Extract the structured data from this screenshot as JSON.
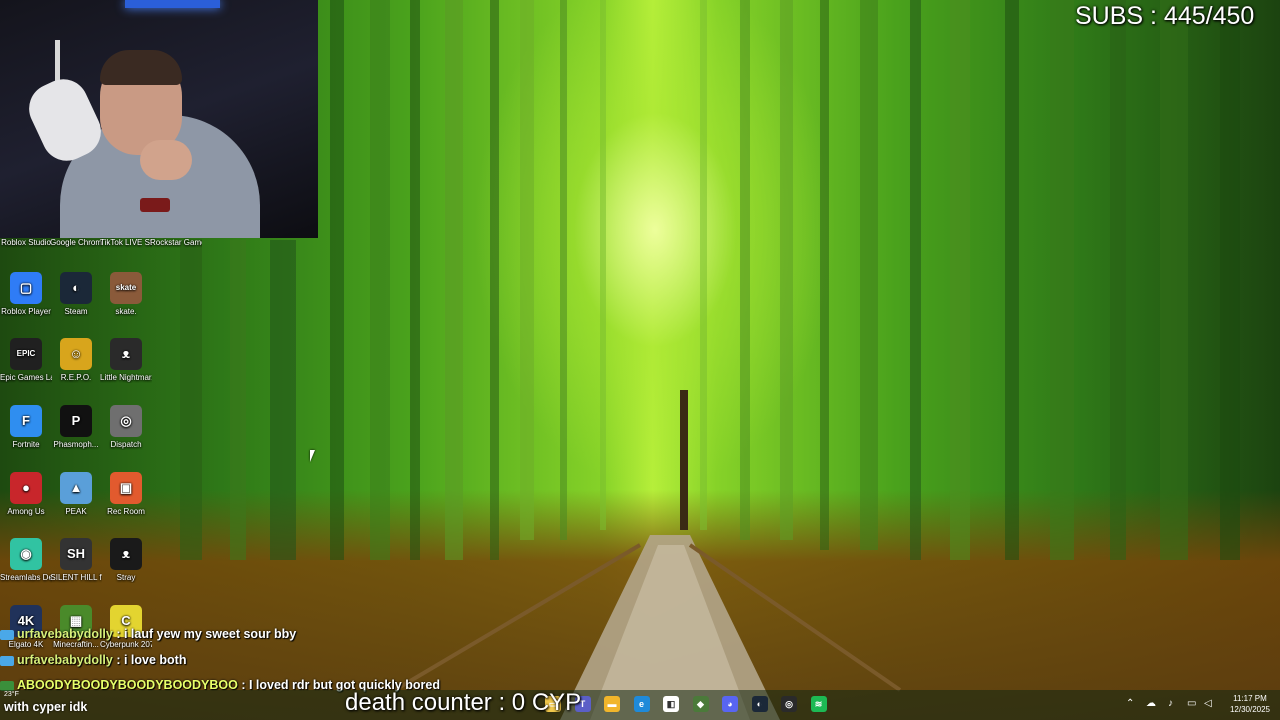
{
  "overlay": {
    "subs": "SUBS : 445/450",
    "death_counter": "death counter : 0",
    "partial_cyp": "CYP"
  },
  "desktop_icons": [
    {
      "label": "Roblox Studio",
      "color": "#1b1b1b",
      "glyph": ""
    },
    {
      "label": "Google Chrome",
      "color": "#1b1b1b",
      "glyph": ""
    },
    {
      "label": "TikTok LIVE Studio",
      "color": "#1b1b1b",
      "glyph": ""
    },
    {
      "label": "Rockstar Games...",
      "color": "#1b1b1b",
      "glyph": ""
    },
    {
      "label": "Roblox Player",
      "color": "#2f7cf6",
      "glyph": "▢"
    },
    {
      "label": "Steam",
      "color": "#1b2838",
      "glyph": "◐"
    },
    {
      "label": "skate.",
      "color": "#8a5a3a",
      "glyph": "skate"
    },
    {
      "label": "Epic Games Launcher",
      "color": "#202020",
      "glyph": "EPIC"
    },
    {
      "label": "R.E.P.O.",
      "color": "#d8a51c",
      "glyph": "☺"
    },
    {
      "label": "Little Nightmar...",
      "color": "#2a2a2a",
      "glyph": "ᴥ"
    },
    {
      "label": "Fortnite",
      "color": "#2f8ef0",
      "glyph": "F"
    },
    {
      "label": "Phasmoph...",
      "color": "#111111",
      "glyph": "P"
    },
    {
      "label": "Dispatch",
      "color": "#6f6f6f",
      "glyph": "◎"
    },
    {
      "label": "Among Us",
      "color": "#c8262b",
      "glyph": "●"
    },
    {
      "label": "PEAK",
      "color": "#5a9fd9",
      "glyph": "▲"
    },
    {
      "label": "Rec Room",
      "color": "#e25a2e",
      "glyph": "▣"
    },
    {
      "label": "Streamlabs Desktop",
      "color": "#31c3a2",
      "glyph": "◉"
    },
    {
      "label": "SILENT HILL f",
      "color": "#333333",
      "glyph": "SH"
    },
    {
      "label": "Stray",
      "color": "#1a1a1a",
      "glyph": "ᴥ"
    },
    {
      "label": "Elgato 4K",
      "color": "#20325a",
      "glyph": "4K"
    },
    {
      "label": "Minecraftin...",
      "color": "#4a8a2a",
      "glyph": "▦"
    },
    {
      "label": "Cyberpunk 2077",
      "color": "#e3d430",
      "glyph": "C"
    }
  ],
  "chat": [
    {
      "user": "urfavebabydolly",
      "message": " : i lauf yew my sweet sour bby"
    },
    {
      "user": "urfavebabydolly",
      "message": " : i love both"
    },
    {
      "user": "ABOODYBOODYBOODYBOODYBOO",
      "message": " : I loved rdr but got quickly bored"
    }
  ],
  "chat_tail": "with cyper idk",
  "weather": "23°F",
  "taskbar": {
    "apps": [
      {
        "name": "explorer",
        "color": "#f2c94c",
        "glyph": "▭"
      },
      {
        "name": "teams",
        "color": "#5b5fc7",
        "glyph": "T"
      },
      {
        "name": "folder",
        "color": "#f1b52b",
        "glyph": "▬"
      },
      {
        "name": "edge",
        "color": "#1f8ad9",
        "glyph": "e"
      },
      {
        "name": "store",
        "color": "#ffffff",
        "glyph": "◧"
      },
      {
        "name": "game",
        "color": "#4b7a3a",
        "glyph": "◆"
      },
      {
        "name": "discord",
        "color": "#5865f2",
        "glyph": "◕"
      },
      {
        "name": "steam",
        "color": "#1b2838",
        "glyph": "◐"
      },
      {
        "name": "obs",
        "color": "#2a2a2a",
        "glyph": "◎"
      },
      {
        "name": "spotify",
        "color": "#1db954",
        "glyph": "≋"
      }
    ],
    "time": "11:17 PM",
    "date": "12/30/2025"
  }
}
